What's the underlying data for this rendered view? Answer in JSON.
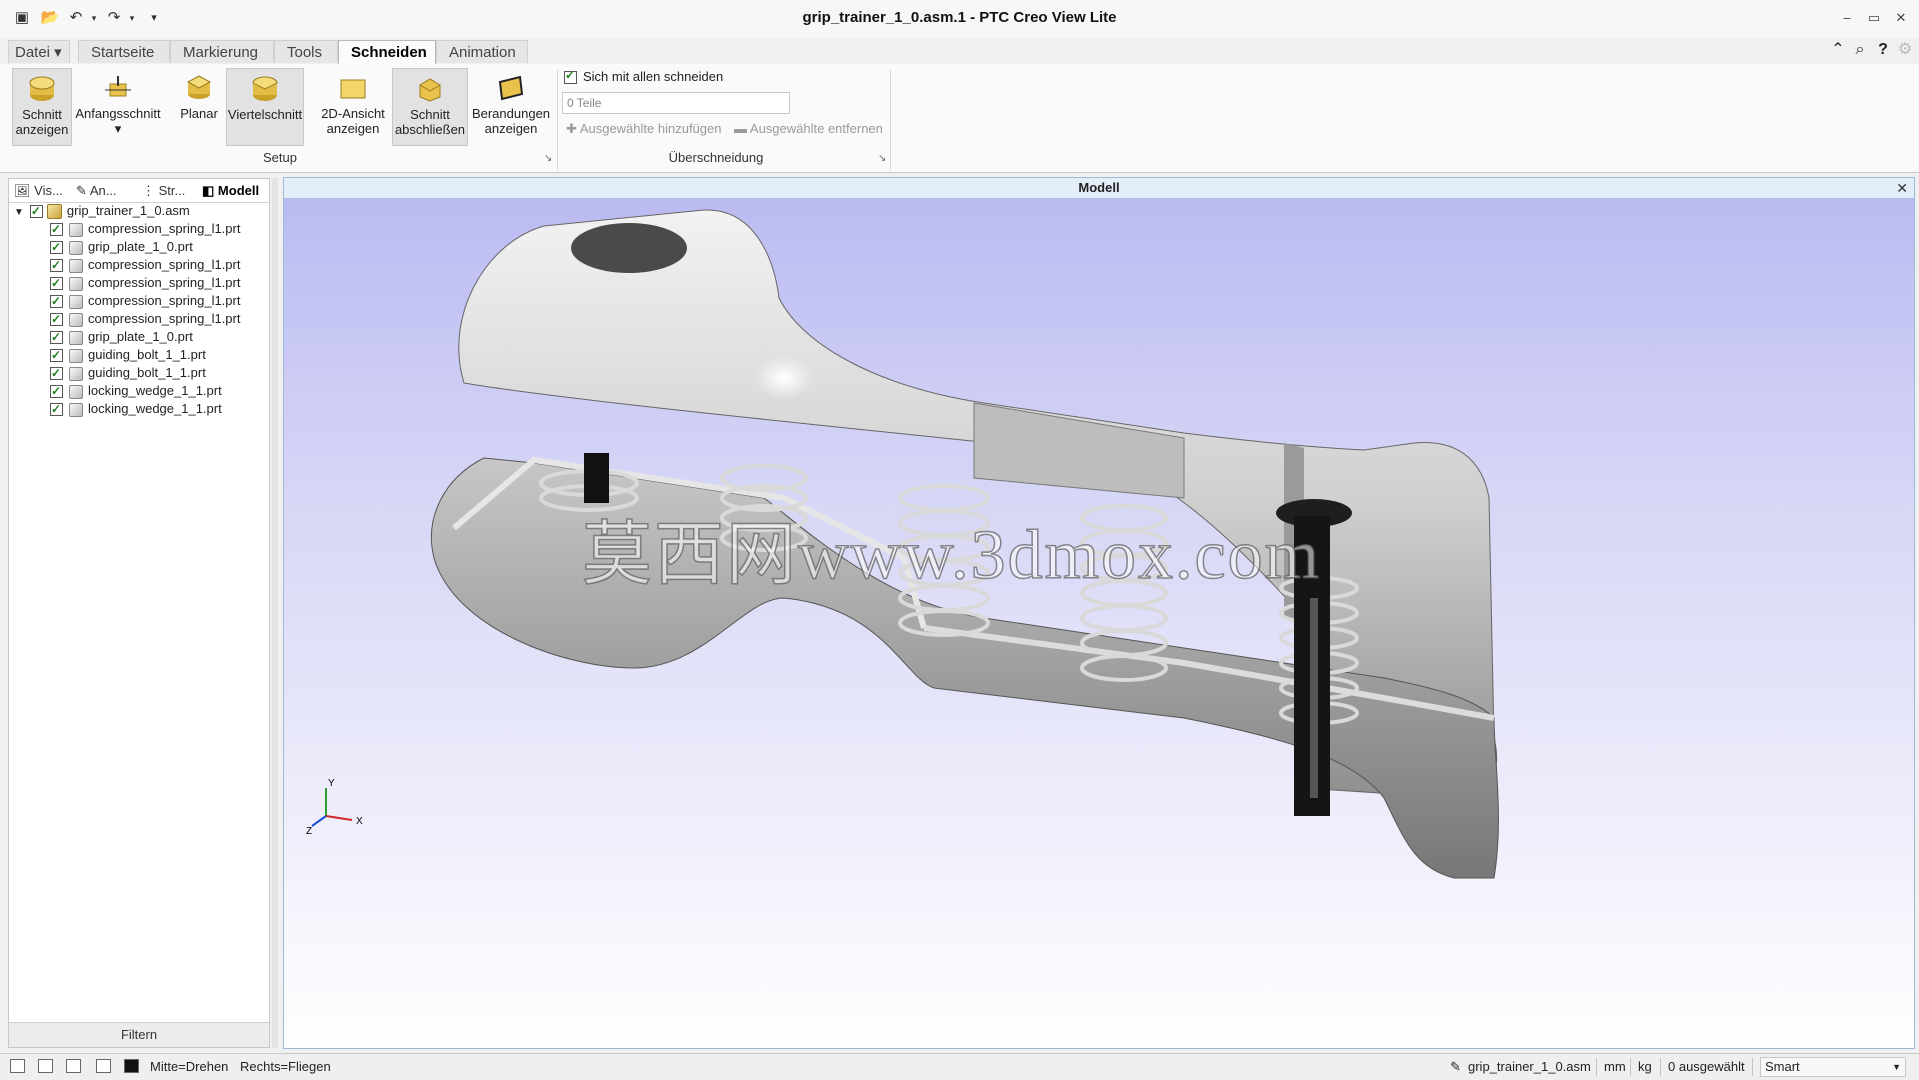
{
  "window": {
    "title": "grip_trainer_1_0.asm.1 - PTC Creo View Lite"
  },
  "ribbon_tabs": [
    {
      "label": "Datei ▾"
    },
    {
      "label": "Startseite"
    },
    {
      "label": "Markierung"
    },
    {
      "label": "Tools"
    },
    {
      "label": "Schneiden"
    },
    {
      "label": "Animation"
    }
  ],
  "active_tab": "Schneiden",
  "ribbon": {
    "buttons": [
      {
        "line1": "Schnitt",
        "line2": "anzeigen",
        "icon": "section-show-icon"
      },
      {
        "line1": "Anfangsschnitt",
        "line2": "▾",
        "icon": "initial-section-icon"
      },
      {
        "line1": "Planar",
        "line2": "",
        "icon": "planar-cut-icon"
      },
      {
        "line1": "Viertelschnitt",
        "line2": "",
        "icon": "quarter-cut-icon"
      },
      {
        "line1": "2D-Ansicht",
        "line2": "anzeigen",
        "icon": "2d-view-icon"
      },
      {
        "line1": "Schnitt",
        "line2": "abschließen",
        "icon": "close-section-icon"
      },
      {
        "line1": "Berandungen",
        "line2": "anzeigen",
        "icon": "show-boundaries-icon"
      }
    ],
    "cut_all_label": "Sich mit allen schneiden",
    "parts_field_value": "0 Teile",
    "add_selected_label": "Ausgewählte hinzufügen",
    "remove_selected_label": "Ausgewählte entfernen",
    "group_setup": "Setup",
    "group_intersection": "Überschneidung"
  },
  "left_panel": {
    "tabs": [
      "Vis...",
      "An...",
      "Str...",
      "Modell"
    ],
    "active_tab": "Modell",
    "root": "grip_trainer_1_0.asm",
    "items": [
      "compression_spring_l1.prt",
      "grip_plate_1_0.prt",
      "compression_spring_l1.prt",
      "compression_spring_l1.prt",
      "compression_spring_l1.prt",
      "compression_spring_l1.prt",
      "grip_plate_1_0.prt",
      "guiding_bolt_1_1.prt",
      "guiding_bolt_1_1.prt",
      "locking_wedge_1_1.prt",
      "locking_wedge_1_1.prt"
    ],
    "filter_label": "Filtern"
  },
  "viewport": {
    "title": "Modell",
    "close": "✕",
    "watermark": "莫西网www.3dmox.com",
    "axis_y": "Y",
    "axis_x": "X",
    "axis_z": "Z"
  },
  "statusbar": {
    "mouse_middle": "Mitte=Drehen",
    "mouse_right": "Rechts=Fliegen",
    "model_name": "grip_trainer_1_0.asm",
    "unit_length": "mm",
    "unit_mass": "kg",
    "selection": "0 ausgewählt",
    "mode": "Smart"
  },
  "colors": {
    "viewport_top": "#b9b9f2",
    "viewport_bottom": "#ffffff",
    "model_grey": "#8a8a8a",
    "spring_color": "#d8d8d8"
  }
}
